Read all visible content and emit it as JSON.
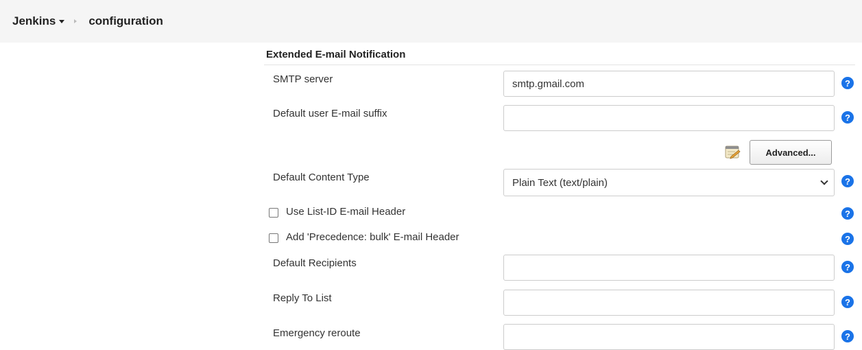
{
  "breadcrumb": {
    "root": "Jenkins",
    "current": "configuration"
  },
  "section": {
    "title": "Extended E-mail Notification"
  },
  "fields": {
    "smtp_server": {
      "label": "SMTP server",
      "value": "smtp.gmail.com"
    },
    "default_suffix": {
      "label": "Default user E-mail suffix",
      "value": ""
    },
    "advanced_button": "Advanced...",
    "content_type": {
      "label": "Default Content Type",
      "value": "Plain Text (text/plain)"
    },
    "list_id": {
      "label": "Use List-ID E-mail Header",
      "checked": false
    },
    "precedence": {
      "label": "Add 'Precedence: bulk' E-mail Header",
      "checked": false
    },
    "default_recipients": {
      "label": "Default Recipients",
      "value": ""
    },
    "reply_to": {
      "label": "Reply To List",
      "value": ""
    },
    "emergency_reroute": {
      "label": "Emergency reroute",
      "value": ""
    }
  },
  "help_icon_glyph": "?",
  "colors": {
    "help_icon": "#1a73e8",
    "breadcrumb_bg": "#f5f5f5"
  }
}
